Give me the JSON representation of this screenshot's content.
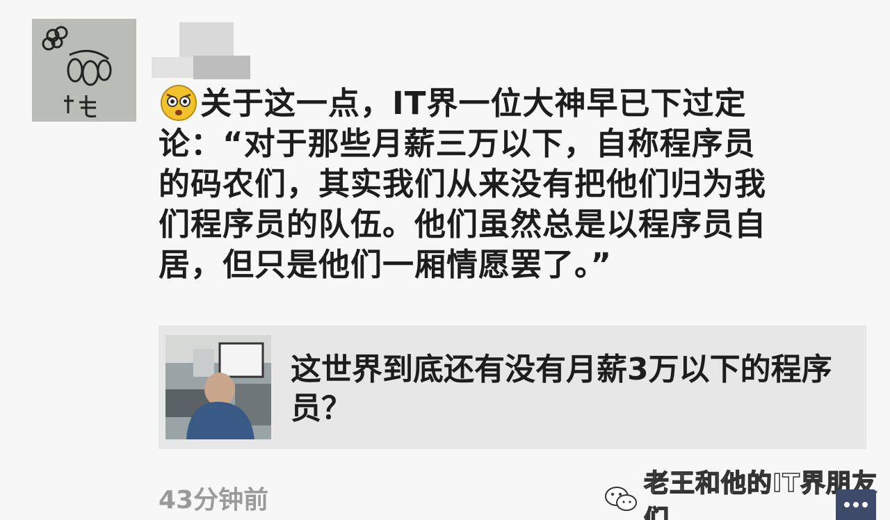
{
  "post": {
    "text_lines": [
      "关于这一点，IT界一位大神早已下过定",
      "论：“对于那些月薪三万以下，自称程序员",
      "的码农们，其实我们从来没有把他们归为我",
      "们程序员的队伍。他们虽然总是以程序员自",
      "居，但只是他们一厢情愿罢了。”"
    ],
    "emoji": "surprised-face"
  },
  "link_card": {
    "title": "这世界到底还有没有月薪3万以下的程序员？"
  },
  "timestamp": "43分钟前",
  "watermark": {
    "text": "老王和他的IT界朋友们",
    "icon": "wechat-icon"
  },
  "colors": {
    "background": "#f7f7f7",
    "card_background": "#e7e7e7",
    "text": "#1d1d1d",
    "timestamp": "#9a9a9a",
    "comment_button": "#3e4a6a"
  }
}
